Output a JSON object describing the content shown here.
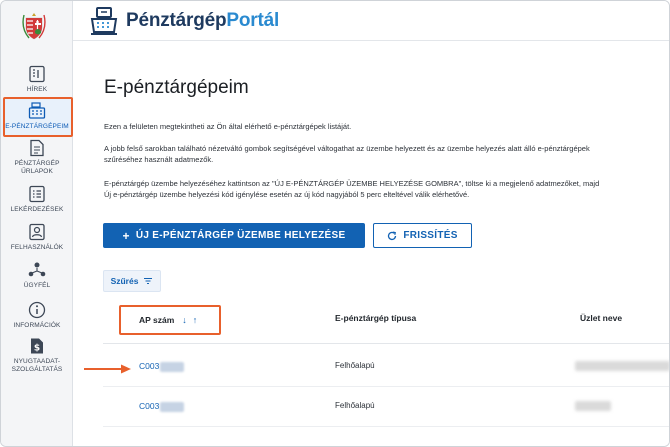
{
  "header": {
    "logo_part1": "Pénztárgép",
    "logo_part2": "Portál"
  },
  "sidebar": {
    "items": [
      {
        "label": "HÍREK",
        "icon": "news-icon"
      },
      {
        "label": "E-PÉNZTÁRGÉPEIM",
        "icon": "cash-register-icon",
        "active": true
      },
      {
        "label_line1": "PÉNZTÁRGÉP",
        "label_line2": "ŰRLAPOK",
        "icon": "form-document-icon"
      },
      {
        "label": "LEKÉRDEZÉSEK",
        "icon": "list-icon"
      },
      {
        "label": "FELHASZNÁLÓK",
        "icon": "user-card-icon"
      },
      {
        "label": "ÜGYFÉL",
        "icon": "client-network-icon"
      },
      {
        "label": "INFORMÁCIÓK",
        "icon": "info-icon"
      },
      {
        "label_line1": "NYUGTAADAT-",
        "label_line2": "SZOLGÁLTATÁS",
        "icon": "receipt-dollar-icon"
      }
    ]
  },
  "main": {
    "title": "E-pénztárgépeim",
    "intro1": "Ezen a felületen megtekintheti az Ön által elérhető e-pénztárgépek listáját.",
    "intro2_line1": "A jobb felső sarokban található nézetváltó gombok segítségével váltogathat az üzembe helyezett és az üzembe helyezés alatt álló e-pénztárgépek",
    "intro2_line2": "szűréséhez használt adatmezők.",
    "intro3_line1": "E-pénztárgép üzembe helyezéséhez kattintson az \"ÚJ E-PÉNZTÁRGÉP ÜZEMBE HELYEZÉSE GOMBRA\", töltse ki a megjelenő adatmezőket, majd",
    "intro3_line2": "Új e-pénztárgép üzembe helyezési kód igénylése esetén az új kód nagyjából 5 perc elteltével válik elérhetővé.",
    "new_button": "ÚJ E-PÉNZTÁRGÉP ÜZEMBE HELYEZÉSE",
    "refresh_button": "FRISSÍTÉS",
    "filter_button": "Szűrés"
  },
  "table": {
    "columns": [
      "AP szám",
      "E-pénztárgép típusa",
      "Üzlet neve"
    ],
    "rows": [
      {
        "ap": "C003",
        "type": "Felhőalapú"
      },
      {
        "ap": "C003",
        "type": "Felhőalapú"
      }
    ]
  },
  "colors": {
    "primary": "#1262b3",
    "highlight": "#e8602c",
    "logo_dark": "#1e3a5f",
    "logo_light": "#2a8ad0"
  }
}
